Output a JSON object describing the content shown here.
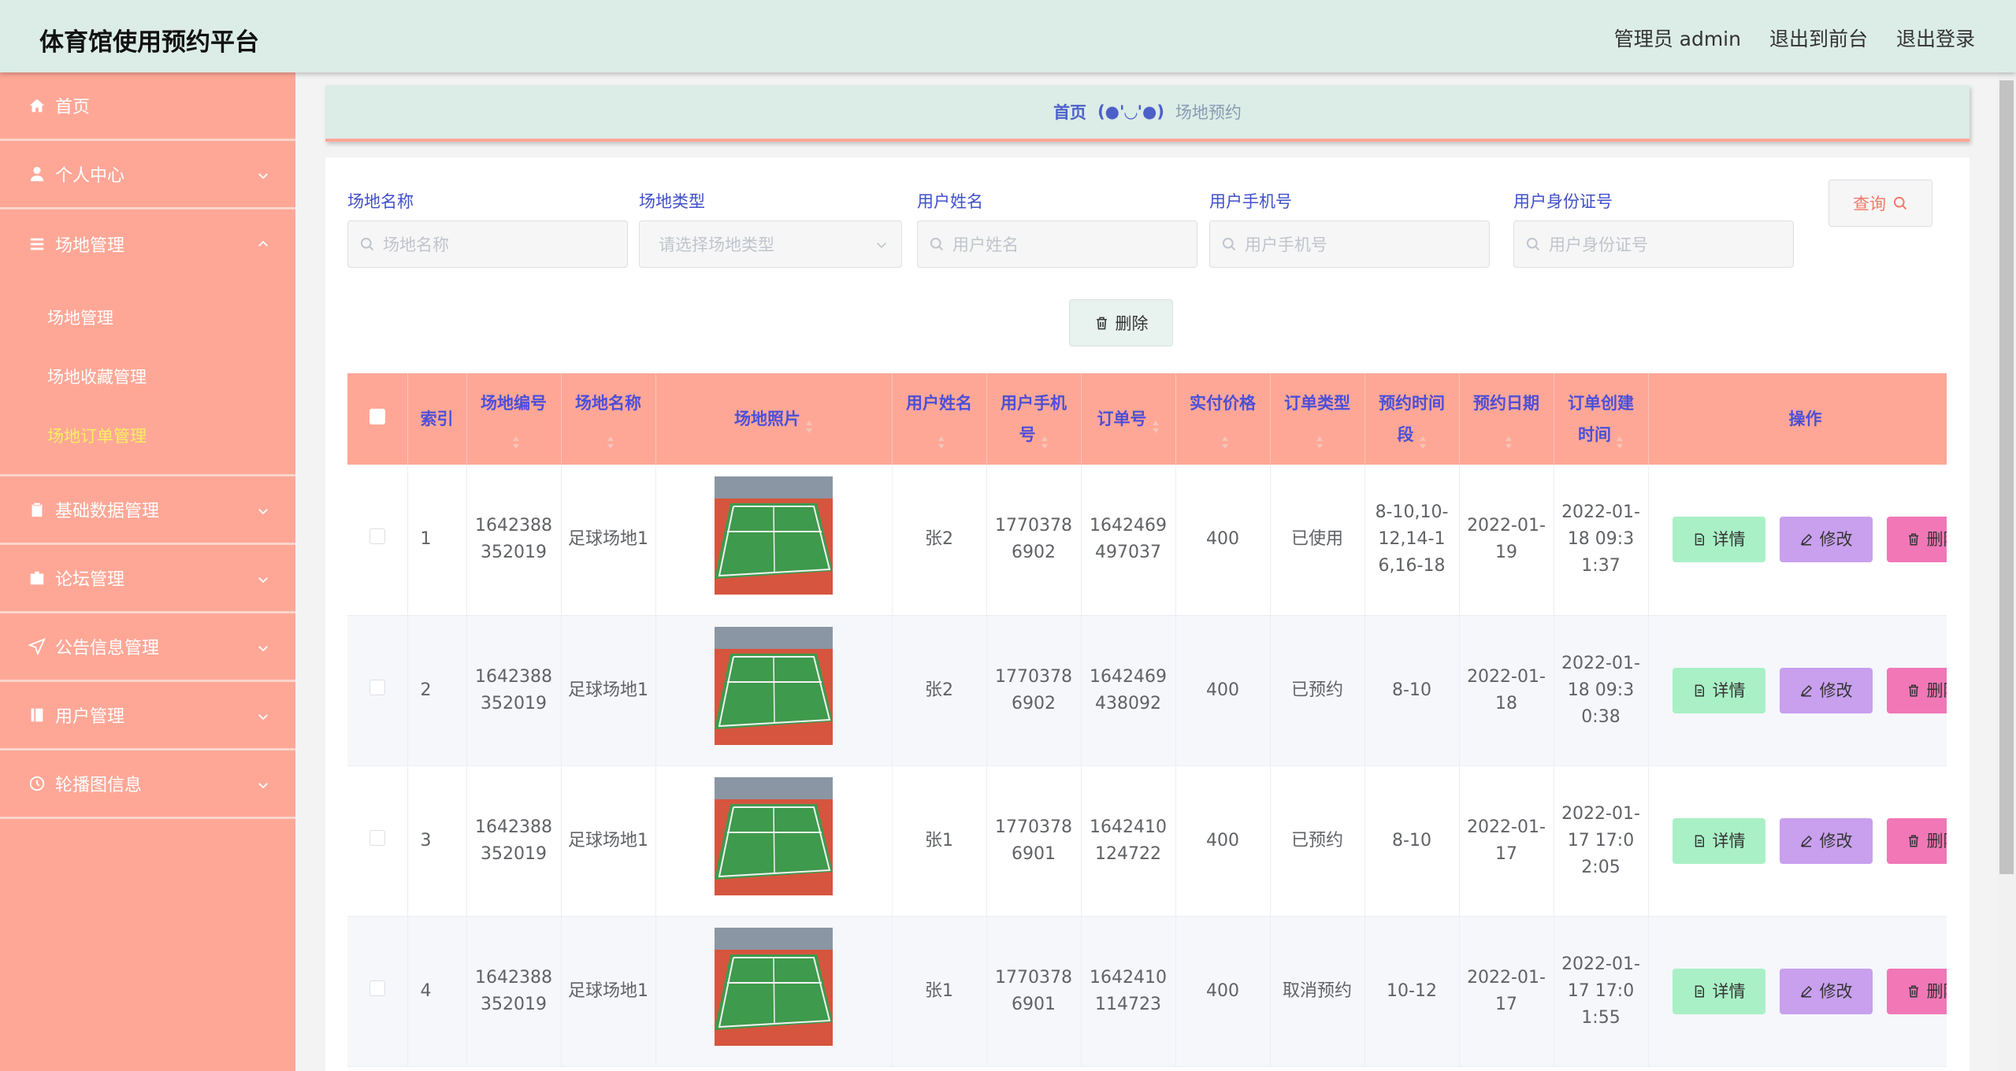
{
  "header": {
    "title": "体育馆使用预约平台",
    "user": "管理员 admin",
    "to_front": "退出到前台",
    "logout": "退出登录"
  },
  "sidebar": {
    "items": [
      {
        "label": "首页",
        "icon": "home-icon"
      },
      {
        "label": "个人中心",
        "icon": "user-icon"
      },
      {
        "label": "场地管理",
        "icon": "list-icon"
      },
      {
        "label": "基础数据管理",
        "icon": "clipboard-icon"
      },
      {
        "label": "论坛管理",
        "icon": "briefcase-icon"
      },
      {
        "label": "公告信息管理",
        "icon": "send-icon"
      },
      {
        "label": "用户管理",
        "icon": "notebook-icon"
      },
      {
        "label": "轮播图信息",
        "icon": "clock-icon"
      }
    ],
    "submenu": [
      {
        "label": "场地管理"
      },
      {
        "label": "场地收藏管理"
      },
      {
        "label": "场地订单管理"
      }
    ]
  },
  "breadcrumb": {
    "home": "首页",
    "separator": "(●'◡'●)",
    "current": "场地预约"
  },
  "search": {
    "fields": [
      {
        "label": "场地名称",
        "placeholder": "场地名称"
      },
      {
        "label": "场地类型",
        "placeholder": "请选择场地类型"
      },
      {
        "label": "用户姓名",
        "placeholder": "用户姓名"
      },
      {
        "label": "用户手机号",
        "placeholder": "用户手机号"
      },
      {
        "label": "用户身份证号",
        "placeholder": "用户身份证号"
      }
    ],
    "query_label": "查询",
    "delete_label": "删除"
  },
  "table": {
    "headers": {
      "index": "索引",
      "venue_no": "场地编号",
      "venue_name": "场地名称",
      "photo": "场地照片",
      "user_name": "用户姓名",
      "user_phone": "用户手机号",
      "order_no": "订单号",
      "price": "实付价格",
      "order_type": "订单类型",
      "time_slot": "预约时间段",
      "date": "预约日期",
      "created": "订单创建时间",
      "ops": "操作"
    },
    "rows": [
      {
        "index": "1",
        "venue_no": "1642388352019",
        "venue_name": "足球场地1",
        "user_name": "张2",
        "user_phone": "17703786902",
        "order_no": "1642469497037",
        "price": "400",
        "order_type": "已使用",
        "time_slot": "8-10,10-12,14-16,16-18",
        "date": "2022-01-19",
        "created": "2022-01-18 09:31:37"
      },
      {
        "index": "2",
        "venue_no": "1642388352019",
        "venue_name": "足球场地1",
        "user_name": "张2",
        "user_phone": "17703786902",
        "order_no": "1642469438092",
        "price": "400",
        "order_type": "已预约",
        "time_slot": "8-10",
        "date": "2022-01-18",
        "created": "2022-01-18 09:30:38"
      },
      {
        "index": "3",
        "venue_no": "1642388352019",
        "venue_name": "足球场地1",
        "user_name": "张1",
        "user_phone": "17703786901",
        "order_no": "1642410124722",
        "price": "400",
        "order_type": "已预约",
        "time_slot": "8-10",
        "date": "2022-01-17",
        "created": "2022-01-17 17:02:05"
      },
      {
        "index": "4",
        "venue_no": "1642388352019",
        "venue_name": "足球场地1",
        "user_name": "张1",
        "user_phone": "17703786901",
        "order_no": "1642410114723",
        "price": "400",
        "order_type": "取消预约",
        "time_slot": "10-12",
        "date": "2022-01-17",
        "created": "2022-01-17 17:01:55"
      }
    ],
    "actions": {
      "detail": "详情",
      "edit": "修改",
      "delete": "删除"
    }
  },
  "colors": {
    "header_bg": "#dcece6",
    "sidebar_bg": "#ffa797",
    "active_sub": "#f7f061",
    "table_head_text": "#4c4fd8",
    "detail_btn": "#a9f0c6",
    "edit_btn": "#c8a0ee",
    "delete_btn": "#f177b7"
  }
}
